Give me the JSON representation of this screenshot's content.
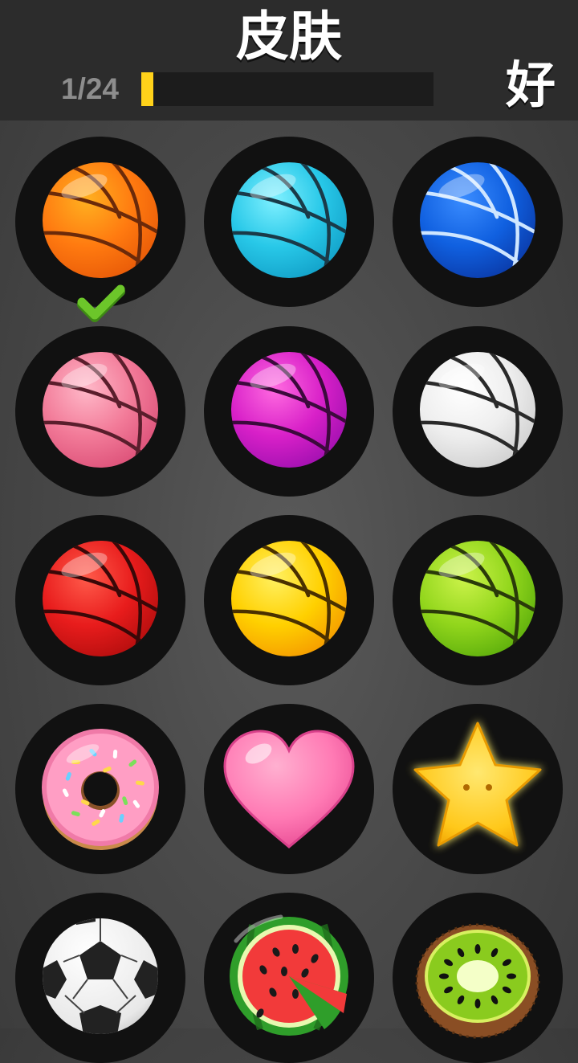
{
  "header": {
    "title": "皮肤",
    "ok_label": "好",
    "progress_text": "1/24",
    "progress_fraction": 0.042
  },
  "colors": {
    "progress_fill": "#ffd21a",
    "check": "#6cc62a"
  },
  "skins": [
    {
      "kind": "basketball",
      "c1": "#ffb020",
      "c2": "#ff7a10",
      "c3": "#e85a08",
      "line": "#6b2a0a",
      "selected": false
    },
    {
      "kind": "basketball",
      "c1": "#7ff0ff",
      "c2": "#28c8e8",
      "c3": "#12a0c8",
      "line": "#1a3a48",
      "selected": false
    },
    {
      "kind": "basketball",
      "c1": "#3a8cff",
      "c2": "#1060e0",
      "c3": "#0a3aa8",
      "line": "#cfe6ff",
      "selected": false
    },
    {
      "kind": "basketball",
      "c1": "#ffb8c8",
      "c2": "#f27a98",
      "c3": "#dc5078",
      "line": "#5a1e2c",
      "selected": true
    },
    {
      "kind": "basketball",
      "c1": "#ff6ae0",
      "c2": "#d820c8",
      "c3": "#a010b0",
      "line": "#3c0a3c",
      "selected": false
    },
    {
      "kind": "basketball",
      "c1": "#ffffff",
      "c2": "#eeeeee",
      "c3": "#cfcfcf",
      "line": "#2a2a2a",
      "selected": false
    },
    {
      "kind": "basketball",
      "c1": "#ff5a4a",
      "c2": "#e81c1c",
      "c3": "#b40e0e",
      "line": "#3a0808",
      "selected": false
    },
    {
      "kind": "basketball",
      "c1": "#fff060",
      "c2": "#ffd000",
      "c3": "#f59a00",
      "line": "#4a3000",
      "selected": false
    },
    {
      "kind": "basketball",
      "c1": "#ccf34a",
      "c2": "#92d61c",
      "c3": "#5cae0c",
      "line": "#2a3a0a",
      "selected": false
    },
    {
      "kind": "donut",
      "selected": false
    },
    {
      "kind": "heart",
      "selected": false
    },
    {
      "kind": "star",
      "selected": false
    },
    {
      "kind": "soccer",
      "selected": false
    },
    {
      "kind": "watermelon",
      "selected": false
    },
    {
      "kind": "kiwi",
      "selected": false
    }
  ]
}
